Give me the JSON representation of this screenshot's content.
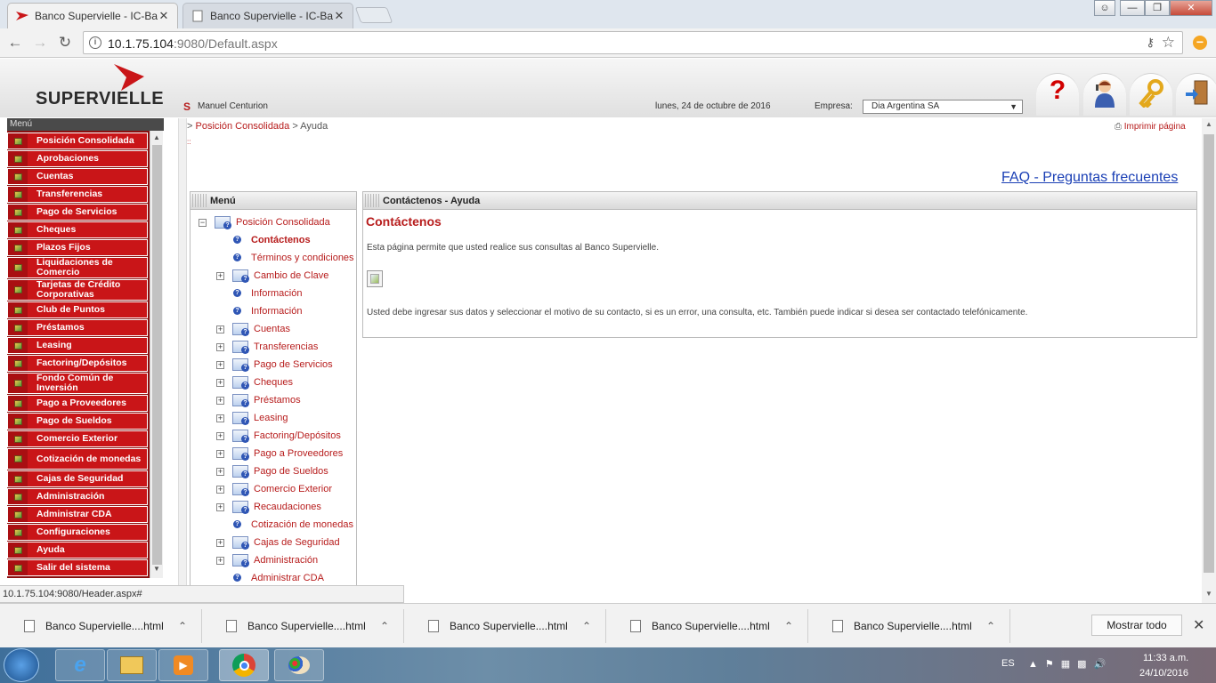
{
  "browser": {
    "tabs": [
      {
        "label": "Banco Supervielle - IC-Ba",
        "close": "✕"
      },
      {
        "label": "Banco Supervielle - IC-Ba",
        "close": "✕"
      }
    ],
    "url_host": "10.1.75.104",
    "url_rest": ":9080/Default.aspx",
    "window_controls": [
      "—",
      "❐",
      "✕"
    ]
  },
  "header": {
    "brand": "SUPERVIELLE",
    "user_name": "Manuel Centurion",
    "date": "lunes, 24 de octubre de 2016",
    "empresa_label": "Empresa:",
    "empresa_value": "Dia Argentina SA",
    "icons": [
      "help-icon",
      "support-agent-icon",
      "key-icon",
      "logout-door-icon"
    ]
  },
  "left_menu": {
    "title": "Menú",
    "items": [
      "Posición Consolidada",
      "Aprobaciones",
      "Cuentas",
      "Transferencias",
      "Pago de Servicios",
      "Cheques",
      "Plazos Fijos",
      "Liquidaciones de Comercio",
      "Tarjetas de Crédito Corporativas",
      "Club de Puntos",
      "Préstamos",
      "Leasing",
      "Factoring/Depósitos",
      "Fondo Común de Inversión",
      "Pago a Proveedores",
      "Pago de Sueldos",
      "Comercio Exterior",
      "Cotización de monedas",
      "Cajas de Seguridad",
      "Administración",
      "Administrar CDA",
      "Configuraciones",
      "Ayuda",
      "Salir del sistema"
    ]
  },
  "breadcrumb": {
    "prefix": ">",
    "link": "Posición Consolidada",
    "sep": ">",
    "current": "Ayuda"
  },
  "print_label": "Imprimir página",
  "dots": "::",
  "faq": "FAQ - Preguntas frecuentes",
  "tree": {
    "title": "Menú",
    "items": [
      {
        "label": "Posición Consolidada",
        "type": "root"
      },
      {
        "label": "Contáctenos",
        "type": "leaf",
        "selected": true
      },
      {
        "label": "Términos y condiciones",
        "type": "leaf"
      },
      {
        "label": "Cambio de Clave",
        "type": "node"
      },
      {
        "label": "Información",
        "type": "leaf"
      },
      {
        "label": "Información",
        "type": "leaf"
      },
      {
        "label": "Cuentas",
        "type": "node"
      },
      {
        "label": "Transferencias",
        "type": "node"
      },
      {
        "label": "Pago de Servicios",
        "type": "node"
      },
      {
        "label": "Cheques",
        "type": "node"
      },
      {
        "label": "Préstamos",
        "type": "node"
      },
      {
        "label": "Leasing",
        "type": "node"
      },
      {
        "label": "Factoring/Depósitos",
        "type": "node"
      },
      {
        "label": "Pago a Proveedores",
        "type": "node"
      },
      {
        "label": "Pago de Sueldos",
        "type": "node"
      },
      {
        "label": "Comercio Exterior",
        "type": "node"
      },
      {
        "label": "Recaudaciones",
        "type": "node"
      },
      {
        "label": "Cotización de monedas",
        "type": "leaf"
      },
      {
        "label": "Cajas de Seguridad",
        "type": "node"
      },
      {
        "label": "Administración",
        "type": "node"
      },
      {
        "label": "Administrar CDA",
        "type": "leaf"
      }
    ]
  },
  "main": {
    "panel_title": "Contáctenos - Ayuda",
    "title": "Contáctenos",
    "desc": "Esta página permite que usted realice sus consultas al Banco Supervielle.",
    "desc2": "Usted debe ingresar sus datos y seleccionar el motivo de su contacto, si es un error, una consulta, etc. También puede indicar si desea ser contactado telefónicamente."
  },
  "status_url": "10.1.75.104:9080/Header.aspx#",
  "downloads": {
    "items": [
      "Banco Supervielle....html",
      "Banco Supervielle....html",
      "Banco Supervielle....html",
      "Banco Supervielle....html",
      "Banco Supervielle....html"
    ],
    "show_all": "Mostrar todo"
  },
  "taskbar": {
    "lang": "ES",
    "time": "11:33 a.m.",
    "date": "24/10/2016"
  },
  "colors": {
    "brand_red": "#c91518",
    "link_red": "#b71c1c",
    "faq_blue": "#1a3fb5"
  }
}
